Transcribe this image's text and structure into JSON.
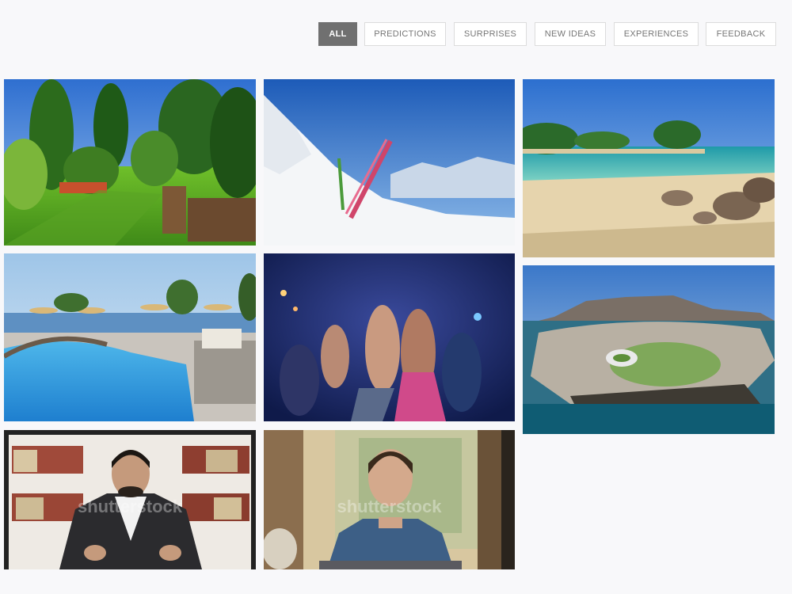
{
  "filters": [
    {
      "label": "ALL",
      "active": true
    },
    {
      "label": "PREDICTIONS",
      "active": false
    },
    {
      "label": "SURPRISES",
      "active": false
    },
    {
      "label": "NEW IDEAS",
      "active": false
    },
    {
      "label": "EXPERIENCES",
      "active": false
    },
    {
      "label": "FEEDBACK",
      "active": false
    }
  ],
  "gallery": {
    "watermark": "shutterstock"
  },
  "colors": {
    "active_filter_bg": "#707070",
    "page_bg": "#f8f8fa"
  }
}
